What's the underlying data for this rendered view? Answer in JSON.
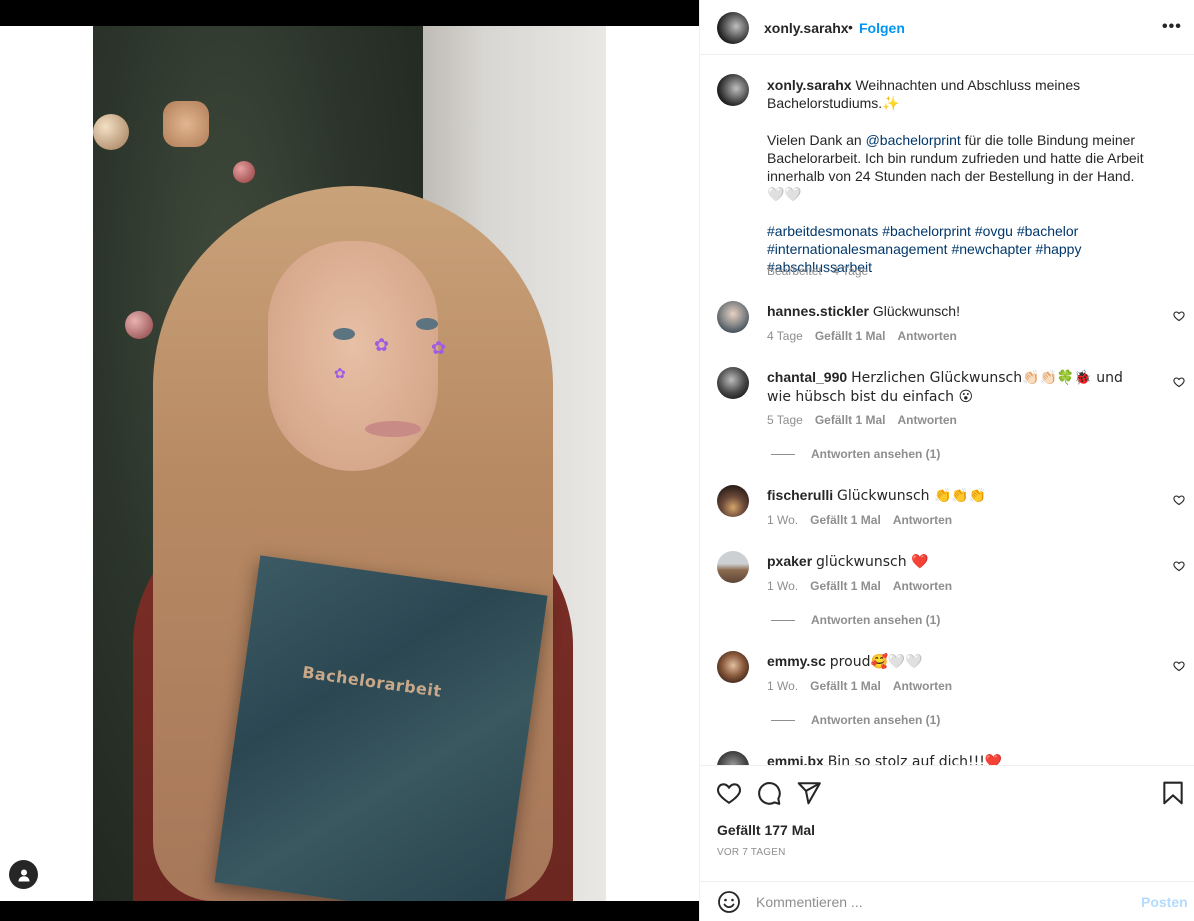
{
  "post": {
    "username": "xonly.sarahx",
    "separator": "•",
    "follow_label": "Folgen",
    "more_label": "•••",
    "book_text": "Bachelorarbeit"
  },
  "caption": {
    "username": "xonly.sarahx",
    "line1": "Weihnachten und Abschluss meines Bachelorstudiums.",
    "line1_emoji": "✨",
    "para2_before": "Vielen Dank an ",
    "mention": "@bachelorprint",
    "para2_after": " für die tolle Bindung meiner Bachelorarbeit. Ich bin rundum zufrieden und hatte die Arbeit innerhalb von 24 Stunden nach der Bestellung in der Hand.",
    "para2_trailing": "🤍🤍",
    "hashtags": [
      "#arbeitdesmonats",
      "#bachelorprint",
      "#ovgu",
      "#bachelor",
      "#internationalesmanagement",
      "#newchapter",
      "#happy",
      "#abschlussarbeit"
    ],
    "meta": "Bearbeitet · 4 Tage"
  },
  "comments": [
    {
      "user": "hannes.stickler",
      "text": "Glückwunsch!",
      "time": "4 Tage",
      "likes": "Gefällt 1 Mal",
      "reply": "Antworten",
      "view_replies": ""
    },
    {
      "user": "chantal_990",
      "text": "Herzlichen Glückwunsch👏🏻👏🏻🍀🐞 und wie hübsch bist du einfach 😮",
      "time": "5 Tage",
      "likes": "Gefällt 1 Mal",
      "reply": "Antworten",
      "view_replies": "Antworten ansehen (1)"
    },
    {
      "user": "fischerulli",
      "text": "Glückwunsch 👏👏👏",
      "time": "1 Wo.",
      "likes": "Gefällt 1 Mal",
      "reply": "Antworten",
      "view_replies": ""
    },
    {
      "user": "pxaker",
      "text": "glückwunsch ❤️",
      "time": "1 Wo.",
      "likes": "Gefällt 1 Mal",
      "reply": "Antworten",
      "view_replies": "Antworten ansehen (1)"
    },
    {
      "user": "emmy.sc",
      "text": "proud🥰🤍🤍",
      "time": "1 Wo.",
      "likes": "Gefällt 1 Mal",
      "reply": "Antworten",
      "view_replies": "Antworten ansehen (1)"
    },
    {
      "user": "emmi.bx",
      "text": "Bin so stolz auf dich!!!❤️",
      "time": "",
      "likes": "",
      "reply": "",
      "view_replies": ""
    }
  ],
  "footer": {
    "likes": "Gefällt 177 Mal",
    "age": "VOR 7 TAGEN",
    "comment_placeholder": "Kommentieren ...",
    "post_label": "Posten"
  },
  "icons": [
    "user-tag-icon",
    "heart-icon",
    "comment-icon",
    "share-icon",
    "bookmark-icon",
    "smiley-icon",
    "small-heart-icon"
  ],
  "colors": {
    "follow": "#0095f6",
    "link": "#00376b",
    "muted": "#8e8e8e",
    "post_disabled": "#b3dbff"
  }
}
